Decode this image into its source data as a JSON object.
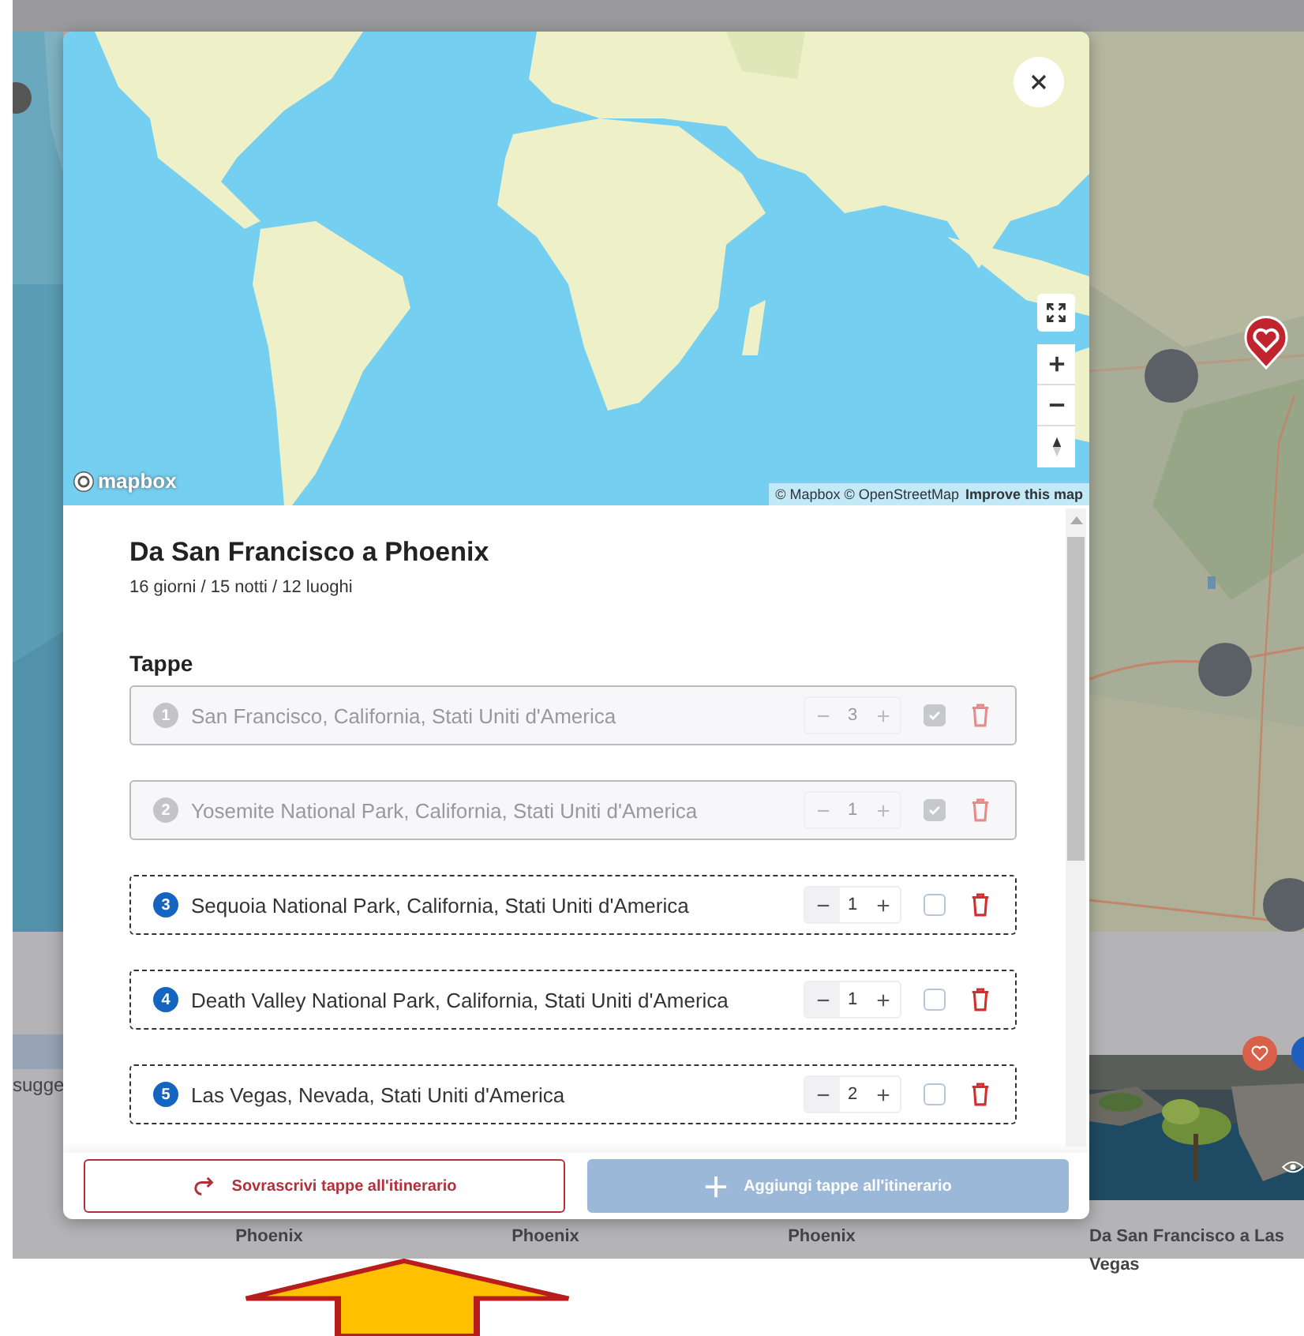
{
  "background": {
    "hint_text": "sugge",
    "cards": [
      {
        "title": "Phoenix",
        "kind": "plain"
      },
      {
        "title": "Phoenix",
        "kind": "plain"
      },
      {
        "title": "Phoenix",
        "kind": "plain"
      },
      {
        "title": "Da San Francisco a Las Vegas",
        "kind": "picture"
      }
    ]
  },
  "dialog": {
    "map": {
      "logo": "mapbox",
      "attribution": "© Mapbox © OpenStreetMap",
      "improve_link": "Improve this map"
    },
    "title": "Da San Francisco a Phoenix",
    "summary": "16 giorni / 15 notti / 12 luoghi",
    "section_label": "Tappe",
    "stops": [
      {
        "number": "1",
        "name": "San Francisco, California, Stati Uniti d'America",
        "nights": "3",
        "checked": true,
        "disabled": true
      },
      {
        "number": "2",
        "name": "Yosemite National Park, California, Stati Uniti d'America",
        "nights": "1",
        "checked": true,
        "disabled": true
      },
      {
        "number": "3",
        "name": "Sequoia National Park, California, Stati Uniti d'America",
        "nights": "1",
        "checked": false,
        "disabled": false
      },
      {
        "number": "4",
        "name": "Death Valley National Park, California, Stati Uniti d'America",
        "nights": "1",
        "checked": false,
        "disabled": false
      },
      {
        "number": "5",
        "name": "Las Vegas, Nevada, Stati Uniti d'America",
        "nights": "2",
        "checked": false,
        "disabled": false
      }
    ],
    "buttons": [
      {
        "label": "Sovrascrivi tappe all'itinerario",
        "kind": "outline",
        "disabled": false
      },
      {
        "label": "Aggiungi tappe all'itinerario",
        "kind": "filled",
        "disabled": true
      }
    ]
  }
}
